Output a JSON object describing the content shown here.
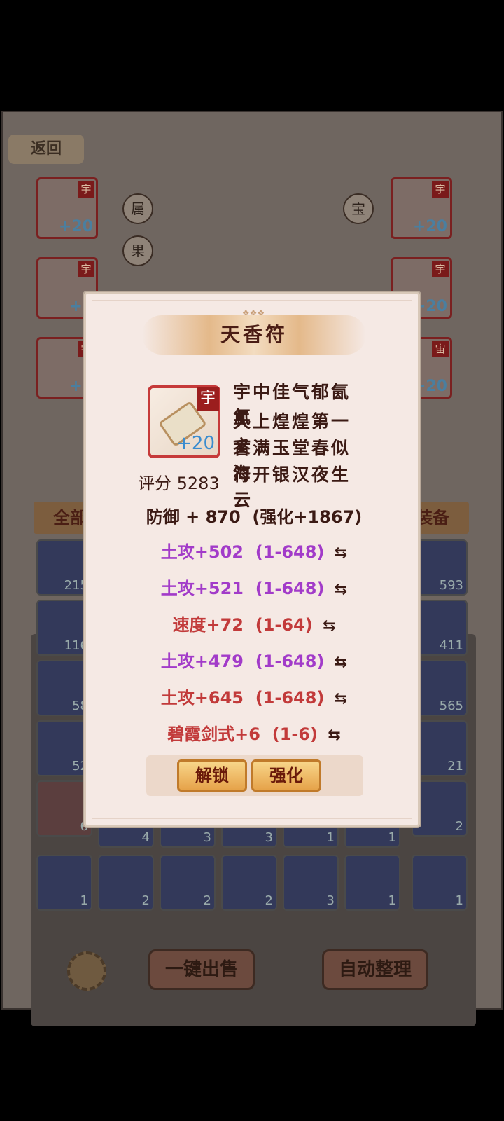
{
  "background": {
    "back_label": "返回",
    "left_equip_plus": [
      "+20",
      "+2",
      "+2"
    ],
    "right_equip_plus": [
      "+20",
      "+20",
      "+20"
    ],
    "left_equip_tags": [
      "宇",
      "宇",
      "宇"
    ],
    "right_equip_tags": [
      "宇",
      "宇",
      "宙"
    ],
    "attr_circle": "属",
    "fruit_circle": "果",
    "treasure_circle": "宝",
    "filter_all": "全部",
    "filter_equip": "装备",
    "inventory_counts_left": [
      "215",
      "116",
      "58",
      "52",
      "6"
    ],
    "inventory_counts_right": [
      "593",
      "411",
      "565",
      "21",
      "2"
    ],
    "row_counts_a": [
      "4",
      "3",
      "3",
      "1",
      "1"
    ],
    "row_counts_b": [
      "1",
      "2",
      "2",
      "2",
      "3",
      "1",
      "1"
    ],
    "sell_all_label": "一键出售",
    "auto_sort_label": "自动整理"
  },
  "dialog": {
    "title": "天香符",
    "item_tag": "宇",
    "item_plus": "+20",
    "poem": [
      "宇中佳气郁氤氲",
      "天上煌煌第一文",
      "香满玉堂春似海",
      "符开银汉夜生云"
    ],
    "score_label": "评分",
    "score_value": "5283",
    "main_stat": "防御 + 870",
    "main_enhance": "(强化+1867)",
    "substats": [
      {
        "text": "土攻+502",
        "range": "(1-648)",
        "color": "purple"
      },
      {
        "text": "土攻+521",
        "range": "(1-648)",
        "color": "purple"
      },
      {
        "text": "速度+72",
        "range": "(1-64)",
        "color": "red"
      },
      {
        "text": "土攻+479",
        "range": "(1-648)",
        "color": "purple"
      },
      {
        "text": "土攻+645",
        "range": "(1-648)",
        "color": "red"
      },
      {
        "text": "碧霞剑式+6",
        "range": "(1-6)",
        "color": "red"
      }
    ],
    "unlock_label": "解锁",
    "enhance_label": "强化"
  },
  "colors": {
    "purple_stat": "#a23bc9",
    "red_stat": "#c23a3a",
    "dialog_bg": "#f5e9e4"
  }
}
